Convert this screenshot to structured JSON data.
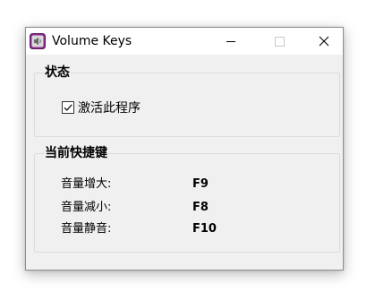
{
  "window": {
    "title": "Volume Keys",
    "app_icon": "speaker-icon",
    "controls": {
      "minimize": "minimize-icon",
      "maximize": "maximize-icon",
      "close": "close-icon"
    }
  },
  "status_group": {
    "title": "状态",
    "enable_checkbox": {
      "label": "激活此程序",
      "checked": true
    }
  },
  "hotkeys_group": {
    "title": "当前快捷键",
    "rows": [
      {
        "label": "音量增大:",
        "key": "F9"
      },
      {
        "label": "音量减小:",
        "key": "F8"
      },
      {
        "label": "音量静音:",
        "key": "F10"
      }
    ]
  },
  "colors": {
    "window_bg": "#f0f0f0",
    "titlebar_bg": "#ffffff",
    "icon_accent": "#8e2a8f"
  }
}
